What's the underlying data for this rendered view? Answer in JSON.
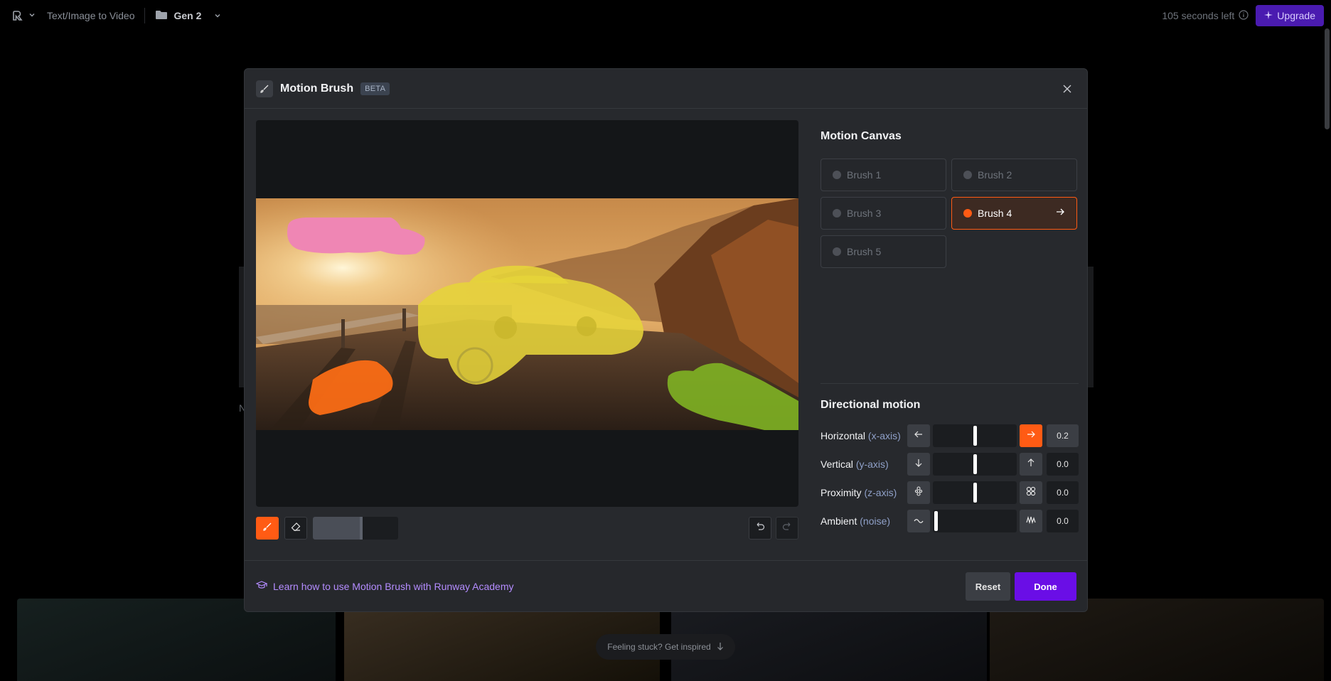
{
  "topbar": {
    "mode_label": "Text/Image to Video",
    "folder_name": "Gen 2",
    "time_left": "105 seconds left",
    "upgrade_label": "Upgrade"
  },
  "background": {
    "partial_label": "N",
    "inspire_label": "Feeling stuck? Get inspired"
  },
  "modal": {
    "title": "Motion Brush",
    "badge": "BETA",
    "canvas_title": "Motion Canvas",
    "brushes": [
      {
        "label": "Brush 1",
        "active": false
      },
      {
        "label": "Brush 2",
        "active": false
      },
      {
        "label": "Brush 3",
        "active": false
      },
      {
        "label": "Brush 4",
        "active": true
      },
      {
        "label": "Brush 5",
        "active": false
      }
    ],
    "brush_size": 0.57,
    "directional_title": "Directional motion",
    "controls": [
      {
        "label": "Horizontal",
        "axis": "(x-axis)",
        "value": "0.2",
        "level": 0.5
      },
      {
        "label": "Vertical",
        "axis": "(y-axis)",
        "value": "0.0",
        "level": 0.5
      },
      {
        "label": "Proximity",
        "axis": "(z-axis)",
        "value": "0.0",
        "level": 0.5
      },
      {
        "label": "Ambient",
        "axis": "(noise)",
        "value": "0.0",
        "level": 0.0
      }
    ],
    "learn_link": "Learn how to use Motion Brush with Runway Academy",
    "reset_label": "Reset",
    "done_label": "Done"
  },
  "colors": {
    "accent": "#ff5b14",
    "primary": "#6a0ee6",
    "link": "#b48cff",
    "upgrade": "#4a1bb0"
  }
}
